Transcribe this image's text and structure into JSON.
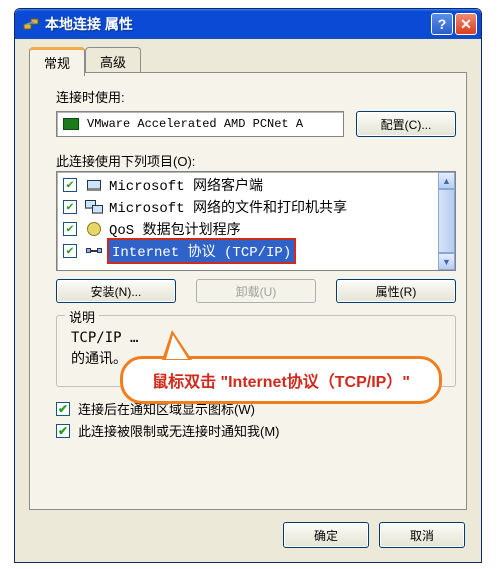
{
  "window": {
    "title": "本地连接 属性"
  },
  "tabs": {
    "general": "常规",
    "advanced": "高级"
  },
  "connect_using_label": "连接时使用:",
  "adapter": {
    "name": "VMware Accelerated AMD PCNet A"
  },
  "configure_btn": "配置(C)...",
  "items_label": "此连接使用下列项目(O):",
  "items": [
    {
      "label": "Microsoft 网络客户端",
      "checked": true,
      "icon": "client"
    },
    {
      "label": "Microsoft 网络的文件和打印机共享",
      "checked": true,
      "icon": "share"
    },
    {
      "label": "QoS 数据包计划程序",
      "checked": true,
      "icon": "qos"
    },
    {
      "label": "Internet 协议 (TCP/IP)",
      "checked": true,
      "icon": "tcpip",
      "selected": true
    }
  ],
  "buttons": {
    "install": "安装(N)...",
    "uninstall": "卸载(U)",
    "properties": "属性(R)"
  },
  "description": {
    "legend": "说明",
    "text": "TCP/IP 是默认的广域网络协议，它提供在不同的相互连接的网络上的通讯。",
    "visible_text": "TCP/IP ……\n的通讯。"
  },
  "options": {
    "show_icon": "连接后在通知区域显示图标(W)",
    "notify_limited": "此连接被限制或无连接时通知我(M)"
  },
  "bottom_buttons": {
    "ok": "确定",
    "cancel": "取消"
  },
  "callout": {
    "text": "鼠标双击 \"Internet协议（TCP/IP）\""
  }
}
